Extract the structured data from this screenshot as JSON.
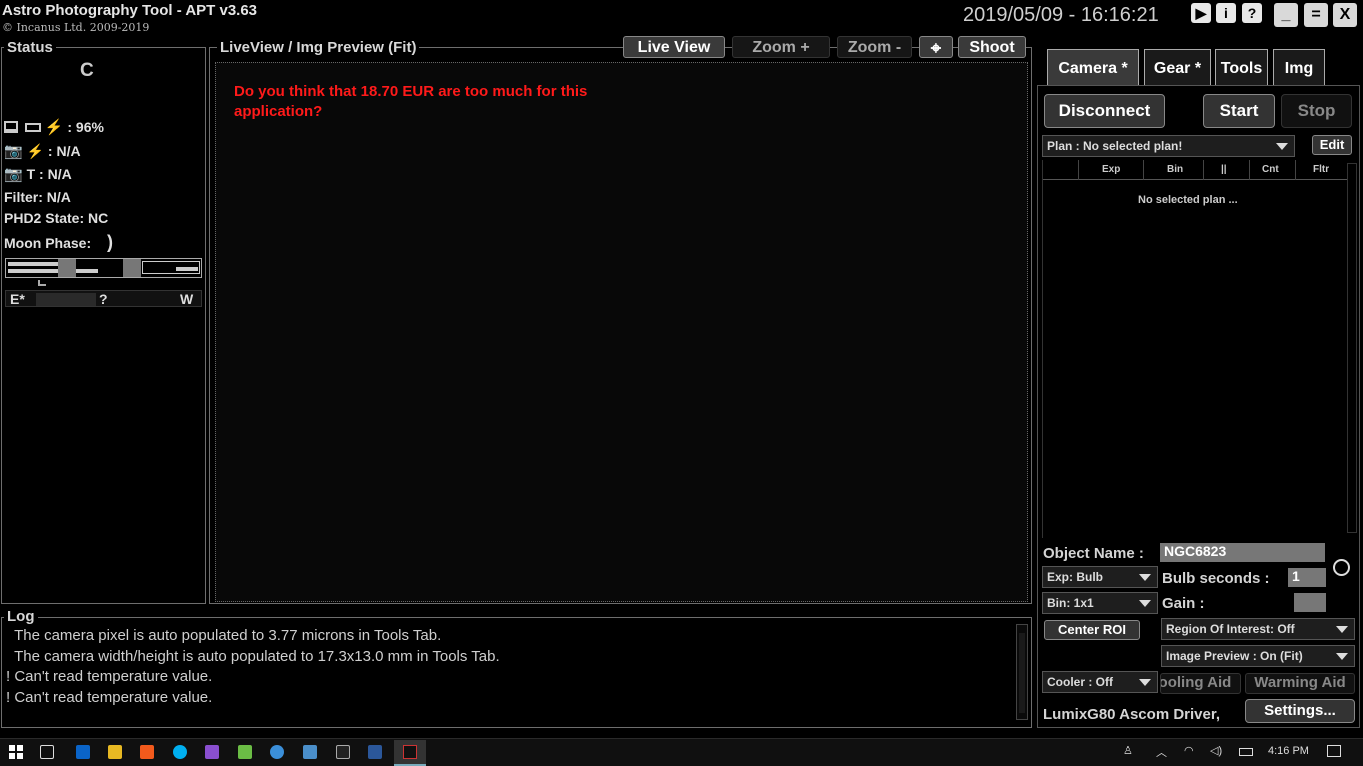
{
  "titlebar": {
    "title": "Astro Photography Tool  -  APT v3.63",
    "copyright": "© Incanus Ltd. 2009-2019",
    "datetime": "2019/05/09 - 16:16:21",
    "icons": [
      "play-icon",
      "info-icon",
      "help-icon"
    ],
    "window_buttons": [
      "minimize-button",
      "restore-button",
      "close-button"
    ]
  },
  "status": {
    "label": "Status",
    "connection_letter": "C",
    "battery": ": 96%",
    "camera_battery": ": N/A",
    "camera_temp_label": "T :",
    "camera_temp": "N/A",
    "filter": "Filter: N/A",
    "phd2": "PHD2 State: NC",
    "moon_label": "Moon Phase:",
    "moon_glyph": ")",
    "ew_left": "E*",
    "ew_mid": "?",
    "ew_right": "W"
  },
  "preview": {
    "label": "LiveView / Img Preview (Fit)",
    "buttons": {
      "live_view": "Live View",
      "zoom_in": "Zoom +",
      "zoom_out": "Zoom -",
      "shoot": "Shoot"
    },
    "nag_message": "Do you think that 18.70 EUR are too much for this application?"
  },
  "tabs": {
    "camera": "Camera *",
    "gear": "Gear *",
    "tools": "Tools",
    "img": "Img"
  },
  "camera": {
    "disconnect": "Disconnect",
    "start": "Start",
    "stop": "Stop",
    "plan_select": "Plan : No selected plan!",
    "edit": "Edit",
    "plan_columns": [
      "Exp",
      "Bin",
      "||",
      "Cnt",
      "Fltr"
    ],
    "plan_empty": "No selected plan ...",
    "object_name_label": "Object Name :",
    "object_name_value": "NGC6823",
    "exp_select": "Exp: Bulb",
    "bulb_label": "Bulb seconds :",
    "bulb_value": "1",
    "bin_select": "Bin: 1x1",
    "gain_label": "Gain :",
    "center_roi": "Center ROI",
    "roi_select": "Region Of Interest: Off",
    "image_preview_select": "Image Preview : On (Fit)",
    "cooler_select": "Cooler : Off",
    "cooling_aid": "Cooling Aid",
    "warming_aid": "Warming Aid",
    "driver_name": "LumixG80 Ascom Driver,",
    "settings": "Settings..."
  },
  "log": {
    "label": "Log",
    "lines": [
      "  The camera pixel is auto populated to 3.77 microns in Tools Tab.",
      "  The camera width/height is auto populated to 17.3x13.0 mm in Tools Tab.",
      "! Can't read temperature value.",
      "! Can't read temperature value."
    ]
  },
  "taskbar": {
    "time": "4:16 PM",
    "pinned": [
      "start-icon",
      "task-view-icon",
      "outlook-icon",
      "file-explorer-icon",
      "brave-icon",
      "skype-icon",
      "visual-studio-icon",
      "notepad-icon",
      "edge-icon",
      "control-panel-icon",
      "terminal-icon",
      "word-icon",
      "apt-icon"
    ]
  }
}
